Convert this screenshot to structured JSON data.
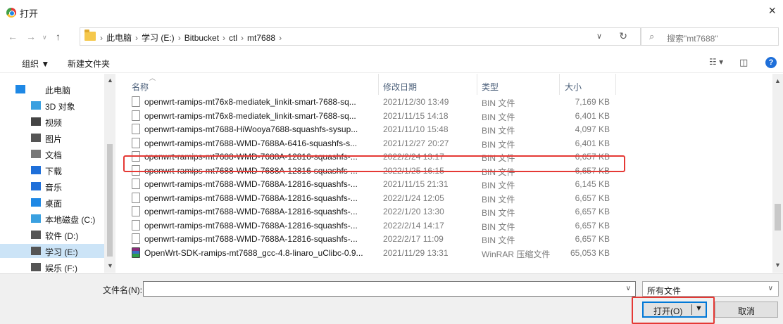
{
  "window": {
    "title": "打开",
    "close_glyph": "×"
  },
  "address": {
    "crumbs": [
      "此电脑",
      "学习 (E:)",
      "Bitbucket",
      "ctl",
      "mt7688"
    ],
    "separator": "›",
    "search_placeholder": "搜索\"mt7688\""
  },
  "toolbar": {
    "organize": "组织 ▼",
    "new_folder": "新建文件夹"
  },
  "navpane": {
    "items": [
      {
        "label": "此电脑",
        "icon": "pc-icon",
        "color": "#1e88e5"
      },
      {
        "label": "3D 对象",
        "icon": "cube-icon",
        "color": "#3aa0e0"
      },
      {
        "label": "视频",
        "icon": "video-icon",
        "color": "#444444"
      },
      {
        "label": "图片",
        "icon": "picture-icon",
        "color": "#555555"
      },
      {
        "label": "文档",
        "icon": "document-icon",
        "color": "#777777"
      },
      {
        "label": "下载",
        "icon": "download-icon",
        "color": "#1e6fd9"
      },
      {
        "label": "音乐",
        "icon": "music-icon",
        "color": "#1e6fd9"
      },
      {
        "label": "桌面",
        "icon": "desktop-icon",
        "color": "#1e88e5"
      },
      {
        "label": "本地磁盘 (C:)",
        "icon": "drive-icon",
        "color": "#3aa0e0"
      },
      {
        "label": "软件 (D:)",
        "icon": "drive-icon",
        "color": "#555555"
      },
      {
        "label": "学习 (E:)",
        "icon": "drive-icon",
        "color": "#555555",
        "selected": true
      },
      {
        "label": "娱乐 (F:)",
        "icon": "drive-icon",
        "color": "#555555"
      }
    ]
  },
  "columns": {
    "name": "名称",
    "date": "修改日期",
    "type": "类型",
    "size": "大小"
  },
  "files": [
    {
      "name": "openwrt-ramips-mt76x8-mediatek_linkit-smart-7688-sq...",
      "date": "2021/12/30 13:49",
      "type": "BIN 文件",
      "size": "7,169 KB"
    },
    {
      "name": "openwrt-ramips-mt76x8-mediatek_linkit-smart-7688-sq...",
      "date": "2021/11/15 14:18",
      "type": "BIN 文件",
      "size": "6,401 KB"
    },
    {
      "name": "openwrt-ramips-mt7688-HiWooya7688-squashfs-sysup...",
      "date": "2021/11/10 15:48",
      "type": "BIN 文件",
      "size": "4,097 KB"
    },
    {
      "name": "openwrt-ramips-mt7688-WMD-7688A-6416-squashfs-s...",
      "date": "2021/12/27 20:27",
      "type": "BIN 文件",
      "size": "6,401 KB"
    },
    {
      "name": "openwrt-ramips-mt7688-WMD-7688A-12816-squashfs-...",
      "date": "2022/2/24 13:17",
      "type": "BIN 文件",
      "size": "6,657 KB",
      "highlighted": true
    },
    {
      "name": "openwrt-ramips-mt7688-WMD-7688A-12816-squashfs-...",
      "date": "2022/1/25 16:15",
      "type": "BIN 文件",
      "size": "6,657 KB"
    },
    {
      "name": "openwrt-ramips-mt7688-WMD-7688A-12816-squashfs-...",
      "date": "2021/11/15 21:31",
      "type": "BIN 文件",
      "size": "6,145 KB"
    },
    {
      "name": "openwrt-ramips-mt7688-WMD-7688A-12816-squashfs-...",
      "date": "2022/1/24 12:05",
      "type": "BIN 文件",
      "size": "6,657 KB"
    },
    {
      "name": "openwrt-ramips-mt7688-WMD-7688A-12816-squashfs-...",
      "date": "2022/1/20 13:30",
      "type": "BIN 文件",
      "size": "6,657 KB"
    },
    {
      "name": "openwrt-ramips-mt7688-WMD-7688A-12816-squashfs-...",
      "date": "2022/2/14 14:17",
      "type": "BIN 文件",
      "size": "6,657 KB"
    },
    {
      "name": "openwrt-ramips-mt7688-WMD-7688A-12816-squashfs-...",
      "date": "2022/2/17 11:09",
      "type": "BIN 文件",
      "size": "6,657 KB"
    },
    {
      "name": "OpenWrt-SDK-ramips-mt7688_gcc-4.8-linaro_uClibc-0.9...",
      "date": "2021/11/29 13:31",
      "type": "WinRAR 压缩文件",
      "size": "65,053 KB",
      "archive": true
    }
  ],
  "bottom": {
    "filename_label": "文件名(N):",
    "filename_value": "",
    "filter": "所有文件",
    "open_label": "打开(O)",
    "cancel_label": "取消"
  },
  "colors": {
    "highlight": "#e53935",
    "accent": "#0078d7",
    "selected": "#cce4f7"
  }
}
